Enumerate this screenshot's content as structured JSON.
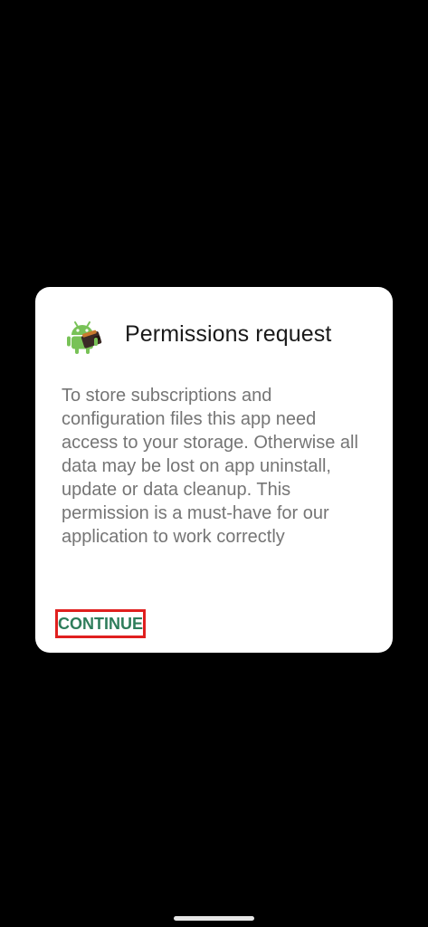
{
  "dialog": {
    "title": "Permissions request",
    "message": "To store subscriptions and configuration files this app need access to your storage. Otherwise all data may be lost on app uninstall, update or data cleanup. This permission is a must-have for our application to work correctly",
    "icon": "android-app-icon",
    "continue_label": "CONTINUE"
  },
  "colors": {
    "background": "#000000",
    "dialog_background": "#ffffff",
    "title": "#1a1a1a",
    "message": "#757575",
    "button_text": "#2e7d5b",
    "highlight_box": "#e0201f",
    "android_green": "#78c257"
  },
  "system": {
    "nav_handle_icon": "gesture-nav-handle"
  }
}
